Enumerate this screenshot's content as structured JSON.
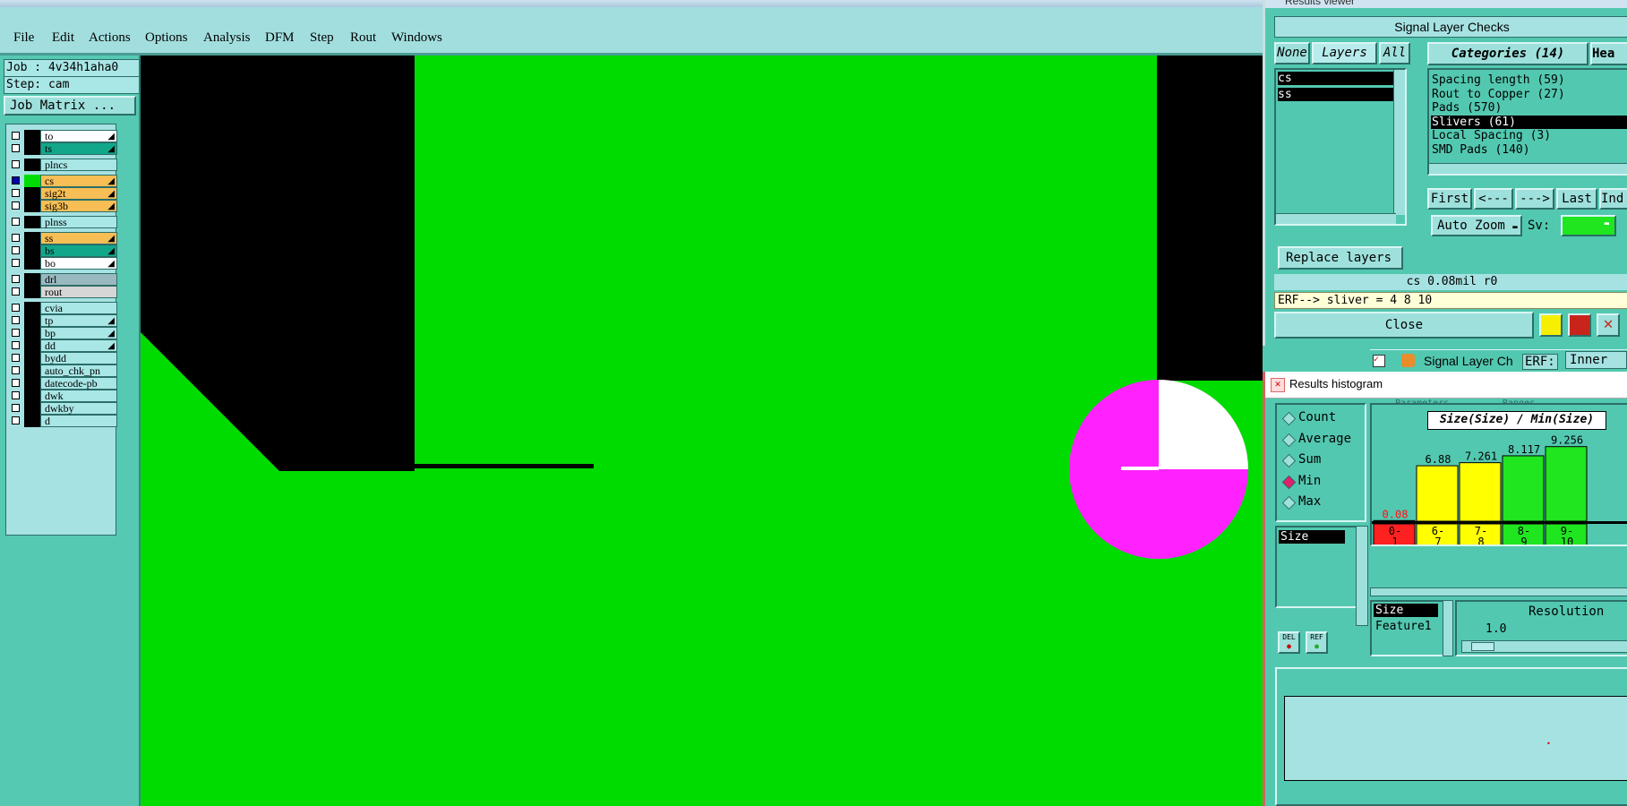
{
  "menu": [
    "File",
    "Edit",
    "Actions",
    "Options",
    "Analysis",
    "DFM",
    "Step",
    "Rout",
    "Windows"
  ],
  "job": {
    "job_line": "Job : 4v34h1aha0",
    "step_line": "Step: cam",
    "job_matrix": "Job Matrix ..."
  },
  "layers": [
    {
      "name": "to",
      "color": "#ffffff",
      "arrow": true,
      "sw": "#000000"
    },
    {
      "name": "ts",
      "color": "#12a78a",
      "arrow": true,
      "sw": "#000000"
    },
    {
      "name": "plncs",
      "color": "#a9e6e6",
      "arrow": false,
      "sw": "#000000"
    },
    {
      "name": "cs",
      "color": "#f7be55",
      "arrow": true,
      "sw": "#00dc00",
      "active": true
    },
    {
      "name": "sig2t",
      "color": "#f7be55",
      "arrow": true,
      "sw": "#000000"
    },
    {
      "name": "sig3b",
      "color": "#f7be55",
      "arrow": true,
      "sw": "#000000"
    },
    {
      "name": "plnss",
      "color": "#a9e6e6",
      "arrow": false,
      "sw": "#000000"
    },
    {
      "name": "ss",
      "color": "#f7be55",
      "arrow": true,
      "sw": "#000000"
    },
    {
      "name": "bs",
      "color": "#12a78a",
      "arrow": true,
      "sw": "#000000"
    },
    {
      "name": "bo",
      "color": "#ffffff",
      "arrow": true,
      "sw": "#000000"
    },
    {
      "name": "drl",
      "color": "#9ab8c0",
      "arrow": false,
      "sw": "#000000"
    },
    {
      "name": "rout",
      "color": "#d6d6d6",
      "arrow": false,
      "sw": "#000000"
    },
    {
      "name": "cvia",
      "color": "#a9e6e6",
      "arrow": false,
      "sw": "#000000"
    },
    {
      "name": "tp",
      "color": "#a9e6e6",
      "arrow": true,
      "sw": "#000000"
    },
    {
      "name": "bp",
      "color": "#a9e6e6",
      "arrow": true,
      "sw": "#000000"
    },
    {
      "name": "dd",
      "color": "#a9e6e6",
      "arrow": true,
      "sw": "#000000"
    },
    {
      "name": "bydd",
      "color": "#a9e6e6",
      "arrow": false,
      "sw": "#000000"
    },
    {
      "name": "auto_chk_pn",
      "color": "#a9e6e6",
      "arrow": false,
      "sw": "#000000"
    },
    {
      "name": "datecode-pb",
      "color": "#a9e6e6",
      "arrow": false,
      "sw": "#000000"
    },
    {
      "name": "dwk",
      "color": "#a9e6e6",
      "arrow": false,
      "sw": "#000000"
    },
    {
      "name": "dwkby",
      "color": "#a9e6e6",
      "arrow": false,
      "sw": "#000000"
    },
    {
      "name": "d",
      "color": "#a9e6e6",
      "arrow": false,
      "sw": "#000000"
    }
  ],
  "viewer": {
    "window_title": "Results viewer",
    "title": "Signal Layer Checks",
    "tabs": {
      "none": "None",
      "layers": "Layers",
      "all": "All"
    },
    "categories_label": "Categories (14)",
    "header_cut": "Hea",
    "layer_items": [
      "cs",
      "ss"
    ],
    "categories": [
      "Spacing length (59)",
      "Rout to Copper (27)",
      "Pads (570)",
      "Slivers (61)",
      "Local Spacing (3)",
      "SMD Pads (140)"
    ],
    "selected_category": "Slivers (61)",
    "nav": {
      "first": "First",
      "prev": "<---",
      "next": "--->",
      "last": "Last",
      "ind": "Ind"
    },
    "auto_zoom": "Auto Zoom",
    "sv_label": "Sv:",
    "replace_layers": "Replace layers",
    "status": "cs 0.08mil  r0",
    "erf_line": "ERF--> sliver = 4 8 10",
    "close": "Close"
  },
  "subbar": {
    "title": "Signal Layer Ch",
    "erf_label": "ERF:",
    "erf_value": "Inner",
    "tab1": "Parameters",
    "tab2": "Ranges"
  },
  "histogram": {
    "window_title": "Results histogram",
    "modes": [
      "Count",
      "Average",
      "Sum",
      "Min",
      "Max"
    ],
    "selected_mode": "Min",
    "list_item": "Size",
    "del": "DEL",
    "ref": "REF",
    "chart_title": "Size(Size) / Min(Size)",
    "fields": [
      "Size",
      "Feature1"
    ],
    "resolution_label": "Resolution",
    "resolution_value": "1.0"
  },
  "chart_data": {
    "type": "bar",
    "title": "Size(Size) / Min(Size)",
    "categories": [
      "0-1",
      "6-7",
      "7-8",
      "8-9",
      "9-10"
    ],
    "values": [
      0.08,
      6.88,
      7.261,
      8.117,
      9.256
    ],
    "labels": [
      "0.08",
      "6.88",
      "7.261",
      "8.117",
      "9.256"
    ],
    "colors": [
      "#ff2020",
      "#ffff00",
      "#ffff00",
      "#1fe61f",
      "#1fe61f"
    ],
    "ylim": [
      0,
      10
    ]
  }
}
